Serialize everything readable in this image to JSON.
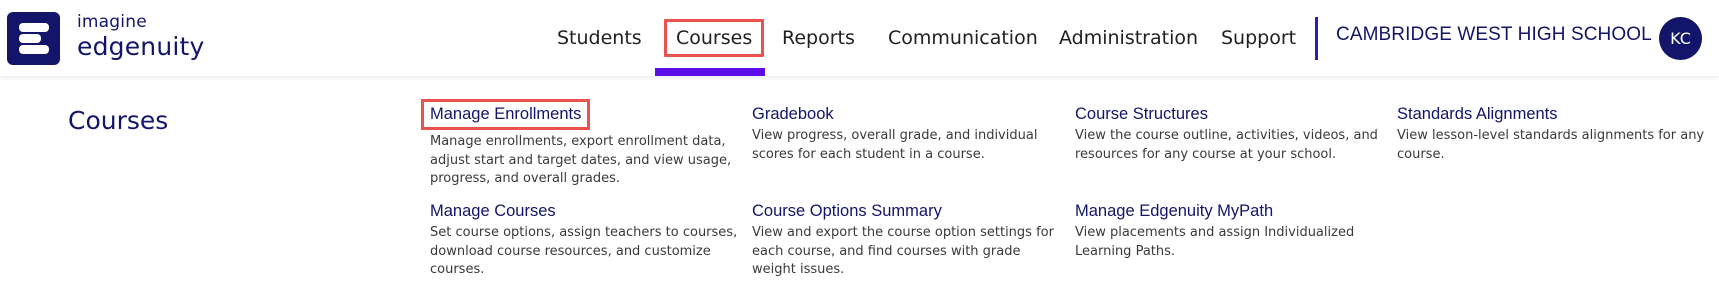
{
  "brand": {
    "logo_line1": "imagine",
    "logo_line2": "edgenuity",
    "logo_icon": "edgenuity-e-logo-icon"
  },
  "nav": {
    "items": [
      {
        "label": "Students"
      },
      {
        "label": "Courses",
        "active": true
      },
      {
        "label": "Reports"
      },
      {
        "label": "Communication"
      },
      {
        "label": "Administration"
      },
      {
        "label": "Support"
      }
    ]
  },
  "school": {
    "name": "CAMBRIDGE WEST HIGH SCHOOL"
  },
  "user": {
    "initials": "KC"
  },
  "dropdown": {
    "title": "Courses",
    "items": [
      {
        "title": "Manage Enrollments",
        "desc": "Manage enrollments, export enrollment data, adjust start and target dates, and view usage, progress, and overall grades.",
        "highlighted": true
      },
      {
        "title": "Gradebook",
        "desc": "View progress, overall grade, and individual scores for each student in a course."
      },
      {
        "title": "Course Structures",
        "desc": "View the course outline, activities, videos, and resources for any course at your school."
      },
      {
        "title": "Standards Alignments",
        "desc": "View lesson-level standards alignments for any course."
      },
      {
        "title": "Manage Courses",
        "desc": "Set course options, assign teachers to courses, download course resources, and customize courses."
      },
      {
        "title": "Course Options Summary",
        "desc": "View and export the course option settings for each course, and find courses with grade weight issues."
      },
      {
        "title": "Manage Edgenuity MyPath",
        "desc": "View placements and assign Individualized Learning Paths."
      }
    ]
  },
  "colors": {
    "brand_navy": "#121569",
    "active_underline": "#5b10e8",
    "highlight_border": "#e9534c"
  }
}
